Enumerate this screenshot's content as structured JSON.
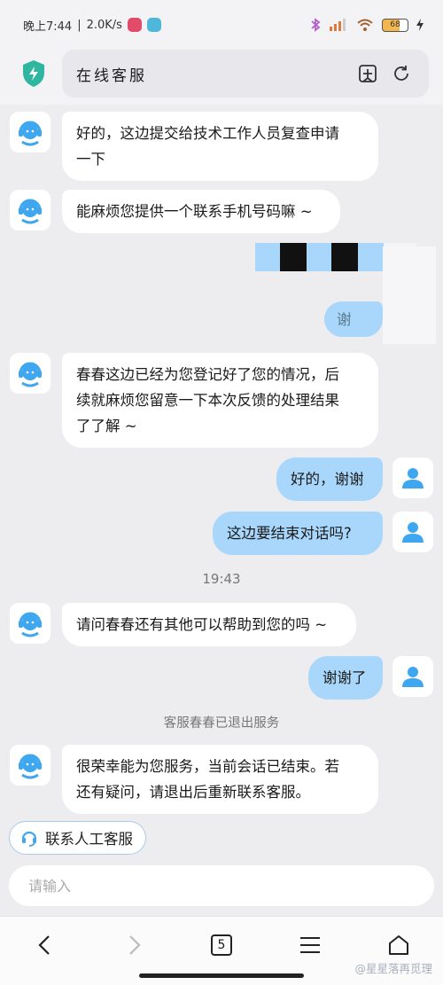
{
  "status_bar": {
    "time": "晚上7:44",
    "network_speed": "2.0K/s",
    "battery": "68"
  },
  "header": {
    "title": "在线客服"
  },
  "messages": [
    {
      "from": "bot",
      "text_lines": [
        "好的，这边提交给技术工作人员复查申请",
        "一下"
      ]
    },
    {
      "from": "bot",
      "text_lines": [
        "能麻烦您提供一个联系手机号码嘛 ~"
      ]
    },
    {
      "from": "me",
      "text_lines": [
        "谢"
      ]
    },
    {
      "from": "bot",
      "text_lines": [
        "春春这边已经为您登记好了您的情况，后",
        "续就麻烦您留意一下本次反馈的处理结果",
        "了了解 ~"
      ]
    },
    {
      "from": "me",
      "text_lines": [
        "好的，谢谢"
      ]
    },
    {
      "from": "me",
      "text_lines": [
        "这边要结束对话吗?"
      ]
    },
    {
      "from": "bot",
      "text_lines": [
        "请问春春还有其他可以帮助到您的吗 ~"
      ]
    },
    {
      "from": "me",
      "text_lines": [
        "谢谢了"
      ]
    },
    {
      "from": "bot",
      "text_lines": [
        "很荣幸能为您服务，当前会话已结束。若",
        "还有疑问，请退出后重新联系客服。"
      ]
    }
  ],
  "timestamp": "19:43",
  "system_notice": "客服春春已退出服务",
  "quick_action": "联系人工客服",
  "input": {
    "placeholder": "请输入",
    "value": ""
  },
  "bottom_nav": {
    "tab_count": "5"
  },
  "watermark": "@星星落再觅理",
  "colors": {
    "user_bubble": "#a9d7fb",
    "bot_bubble": "#ffffff",
    "background": "#ededf0",
    "accent": "#3ea7f0",
    "shield": "#2fb6a0"
  }
}
